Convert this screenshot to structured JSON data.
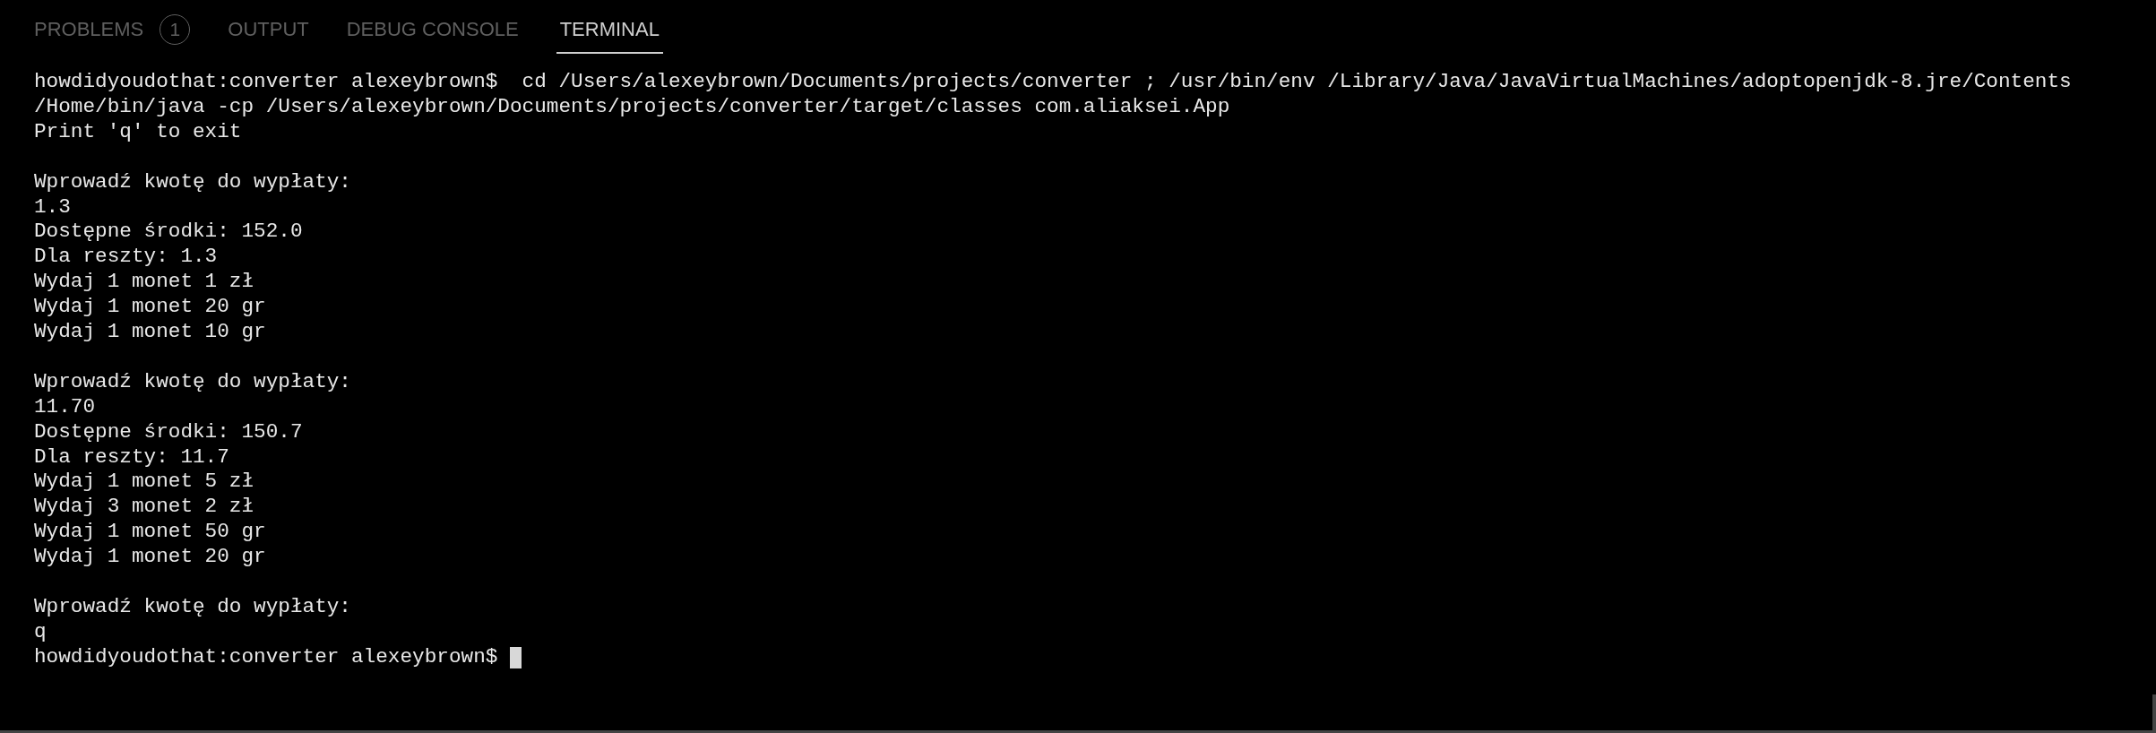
{
  "tabs": [
    {
      "label": "PROBLEMS",
      "selected": false,
      "badge": "1"
    },
    {
      "label": "OUTPUT",
      "selected": false
    },
    {
      "label": "DEBUG CONSOLE",
      "selected": false
    },
    {
      "label": "TERMINAL",
      "selected": true
    }
  ],
  "terminal": {
    "cursor": true,
    "blocks": [
      [
        "howdidyoudothat:converter alexeybrown$  cd /Users/alexeybrown/Documents/projects/converter ; /usr/bin/env /Library/Java/JavaVirtualMachines/adoptopenjdk-8.jre/Contents",
        "/Home/bin/java -cp /Users/alexeybrown/Documents/projects/converter/target/classes com.aliaksei.App",
        "Print 'q' to exit"
      ],
      [
        "Wprowadź kwotę do wypłaty:",
        "1.3",
        "Dostępne środki: 152.0",
        "Dla reszty: 1.3",
        "Wydaj 1 monet 1 zł",
        "Wydaj 1 monet 20 gr",
        "Wydaj 1 monet 10 gr"
      ],
      [
        "Wprowadź kwotę do wypłaty:",
        "11.70",
        "Dostępne środki: 150.7",
        "Dla reszty: 11.7",
        "Wydaj 1 monet 5 zł",
        "Wydaj 3 monet 2 zł",
        "Wydaj 1 monet 50 gr",
        "Wydaj 1 monet 20 gr"
      ],
      [
        "Wprowadź kwotę do wypłaty:",
        "q",
        "howdidyoudothat:converter alexeybrown$"
      ]
    ]
  }
}
